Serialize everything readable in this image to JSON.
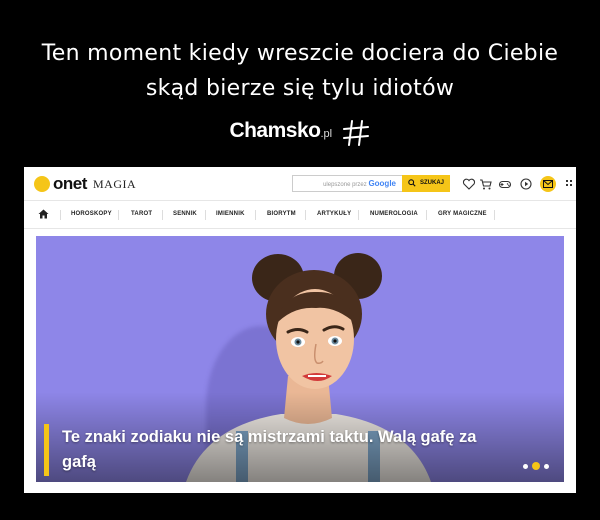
{
  "meme": {
    "caption_line1": "Ten moment kiedy wreszcie dociera do Ciebie",
    "caption_line2": "skąd bierze się tylu idiotów",
    "brand_name": "Chamsko",
    "brand_tld": ".pl"
  },
  "header": {
    "logo_text": "onet",
    "section": "MAGIA",
    "search_placeholder": "ulepszone przez",
    "search_provider": "Google",
    "search_button": "SZUKAJ"
  },
  "nav": {
    "items": [
      "HOROSKOPY",
      "TAROT",
      "SENNIK",
      "IMIENNIK",
      "BIORYTM",
      "ARTYKUŁY",
      "NUMEROLOGIA",
      "GRY MAGICZNE"
    ]
  },
  "hero": {
    "headline": "Te znaki zodiaku nie są mistrzami taktu. Walą gafę za gafą",
    "slide_count": 3,
    "active_slide": 2
  },
  "colors": {
    "accent": "#f5c518",
    "hero_bg": "#8e86e8"
  }
}
